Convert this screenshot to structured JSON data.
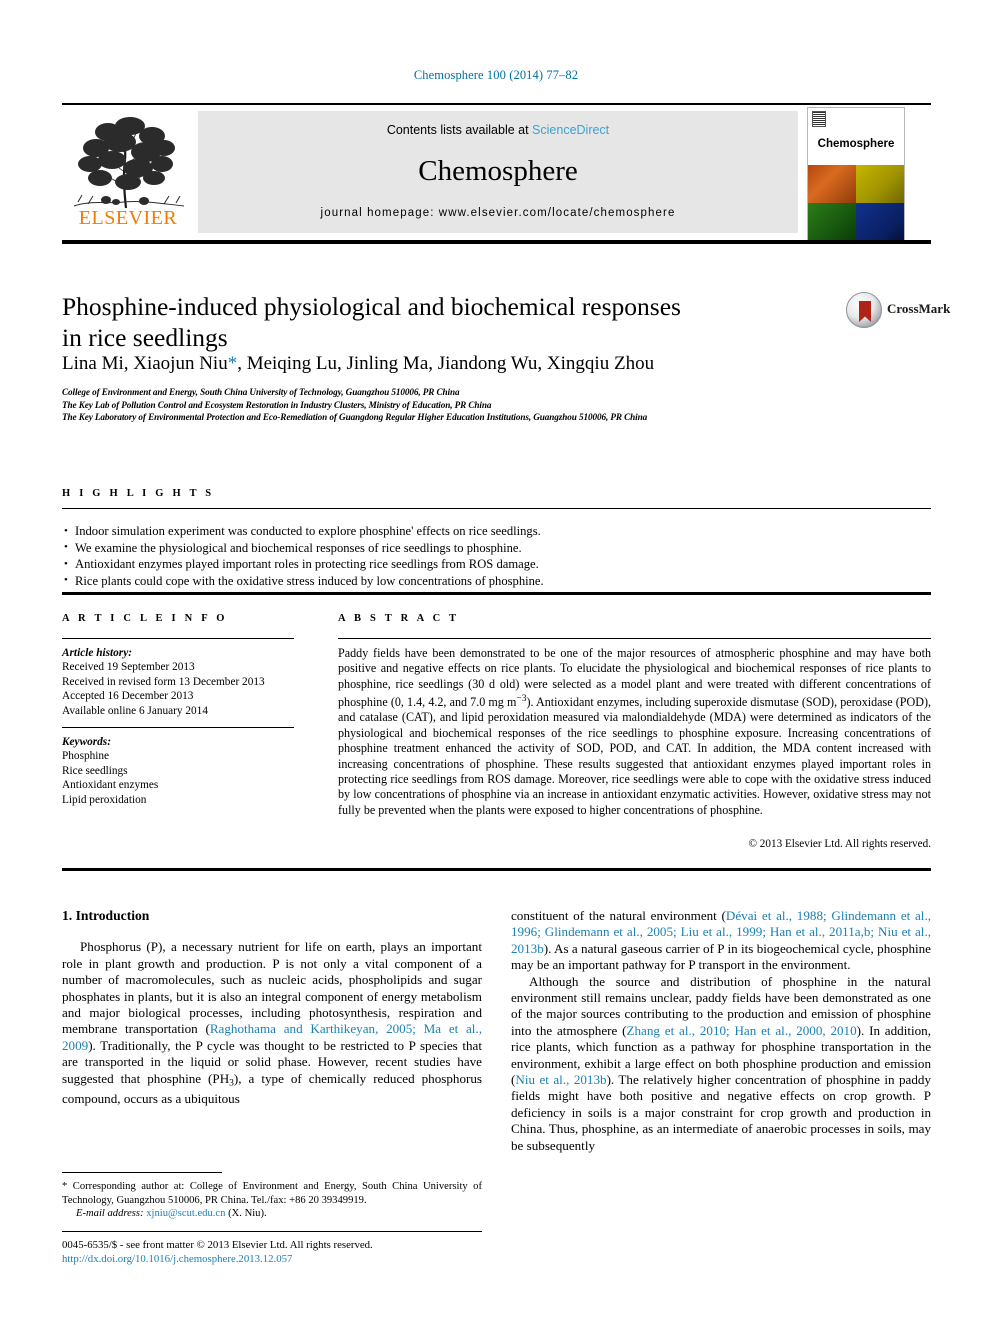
{
  "running_head": "Chemosphere 100 (2014) 77–82",
  "masthead": {
    "contents_prefix": "Contents lists available at ",
    "sciencedirect": "ScienceDirect",
    "journal_title": "Chemosphere",
    "homepage": "journal homepage: www.elsevier.com/locate/chemosphere",
    "publisher": "ELSEVIER",
    "cover_title": "Chemosphere",
    "accent_link": "#3aa3d2",
    "publisher_color": "#f07c00"
  },
  "article": {
    "title_line1": "Phosphine-induced physiological and biochemical responses",
    "title_line2": "in rice seedlings",
    "authors": "Lina Mi, Xiaojun Niu",
    "authors_rest": ", Meiqing Lu, Jinling Ma, Jiandong Wu, Xingqiu Zhou",
    "corresponding_marker": "*",
    "affiliations": [
      "College of Environment and Energy, South China University of Technology, Guangzhou 510006, PR China",
      "The Key Lab of Pollution Control and Ecosystem Restoration in Industry Clusters, Ministry of Education, PR China",
      "The Key Laboratory of Environmental Protection and Eco-Remediation of Guangdong Regular Higher Education Institutions, Guangzhou 510006, PR China"
    ],
    "crossmark_label": "CrossMark"
  },
  "highlights": {
    "heading": "H I G H L I G H T S",
    "items": [
      "Indoor simulation experiment was conducted to explore phosphine' effects on rice seedlings.",
      "We examine the physiological and biochemical responses of rice seedlings to phosphine.",
      "Antioxidant enzymes played important roles in protecting rice seedlings from ROS damage.",
      "Rice plants could cope with the oxidative stress induced by low concentrations of phosphine."
    ]
  },
  "article_info": {
    "heading": "A R T I C L E   I N F O",
    "history_label": "Article history:",
    "history": [
      "Received 19 September 2013",
      "Received in revised form 13 December 2013",
      "Accepted 16 December 2013",
      "Available online 6 January 2014"
    ],
    "keywords_label": "Keywords:",
    "keywords": [
      "Phosphine",
      "Rice seedlings",
      "Antioxidant enzymes",
      "Lipid peroxidation"
    ]
  },
  "abstract": {
    "heading": "A B S T R A C T",
    "part1": "Paddy fields have been demonstrated to be one of the major resources of atmospheric phosphine and may have both positive and negative effects on rice plants. To elucidate the physiological and biochemical responses of rice plants to phosphine, rice seedlings (30 d old) were selected as a model plant and were treated with different concentrations of phosphine (0, 1.4, 4.2, and 7.0 mg m",
    "superscript": "−3",
    "part2": "). Antioxidant enzymes, including superoxide dismutase (SOD), peroxidase (POD), and catalase (CAT), and lipid peroxidation measured via malondialdehyde (MDA) were determined as indicators of the physiological and biochemical responses of the rice seedlings to phosphine exposure. Increasing concentrations of phosphine treatment enhanced the activity of SOD, POD, and CAT. In addition, the MDA content increased with increasing concentrations of phosphine. These results suggested that antioxidant enzymes played important roles in protecting rice seedlings from ROS damage. Moreover, rice seedlings were able to cope with the oxidative stress induced by low concentrations of phosphine via an increase in antioxidant enzymatic activities. However, oxidative stress may not fully be prevented when the plants were exposed to higher concentrations of phosphine.",
    "copyright": "© 2013 Elsevier Ltd. All rights reserved."
  },
  "introduction": {
    "heading": "1. Introduction",
    "left_p1_a": "Phosphorus (P), a necessary nutrient for life on earth, plays an important role in plant growth and production. P is not only a vital component of a number of macromolecules, such as nucleic acids, phospholipids and sugar phosphates in plants, but it is also an integral component of energy metabolism and major biological processes, including photosynthesis, respiration and membrane transportation (",
    "left_p1_ref": "Raghothama and Karthikeyan, 2005; Ma et al., 2009",
    "left_p1_b": "). Traditionally, the P cycle was thought to be restricted to P species that are transported in the liquid or solid phase. However, recent studies have suggested that phosphine (PH",
    "left_p1_sub": "3",
    "left_p1_c": "), a type of chemically reduced phosphorus compound, occurs as a ubiquitous",
    "right_p1_a": "constituent of the natural environment (",
    "right_p1_ref": "Dévai et al., 1988; Glindemann et al., 1996; Glindemann et al., 2005; Liu et al., 1999; Han et al., 2011a,b; Niu et al., 2013b",
    "right_p1_b": "). As a natural gaseous carrier of P in its biogeochemical cycle, phosphine may be an important pathway for P transport in the environment.",
    "right_p2_a": "Although the source and distribution of phosphine in the natural environment still remains unclear, paddy fields have been demonstrated as one of the major sources contributing to the production and emission of phosphine into the atmosphere (",
    "right_p2_ref1": "Zhang et al., 2010; Han et al., 2000, 2010",
    "right_p2_b": "). In addition, rice plants, which function as a pathway for phosphine transportation in the environment, exhibit a large effect on both phosphine production and emission (",
    "right_p2_ref2": "Niu et al., 2013b",
    "right_p2_c": "). The relatively higher concentration of phosphine in paddy fields might have both positive and negative effects on crop growth. P deficiency in soils is a major constraint for crop growth and production in China. Thus, phosphine, as an intermediate of anaerobic processes in soils, may be subsequently"
  },
  "footnote": {
    "marker": "*",
    "text": "Corresponding author at: College of Environment and Energy, South China University of Technology, Guangzhou 510006, PR China. Tel./fax: +86 20 39349919.",
    "email_label": "E-mail address:",
    "email": "xjniu@scut.edu.cn",
    "email_owner": "(X. Niu)."
  },
  "footer": {
    "issn_line": "0045-6535/$ - see front matter © 2013 Elsevier Ltd. All rights reserved.",
    "doi": "http://dx.doi.org/10.1016/j.chemosphere.2013.12.057"
  }
}
